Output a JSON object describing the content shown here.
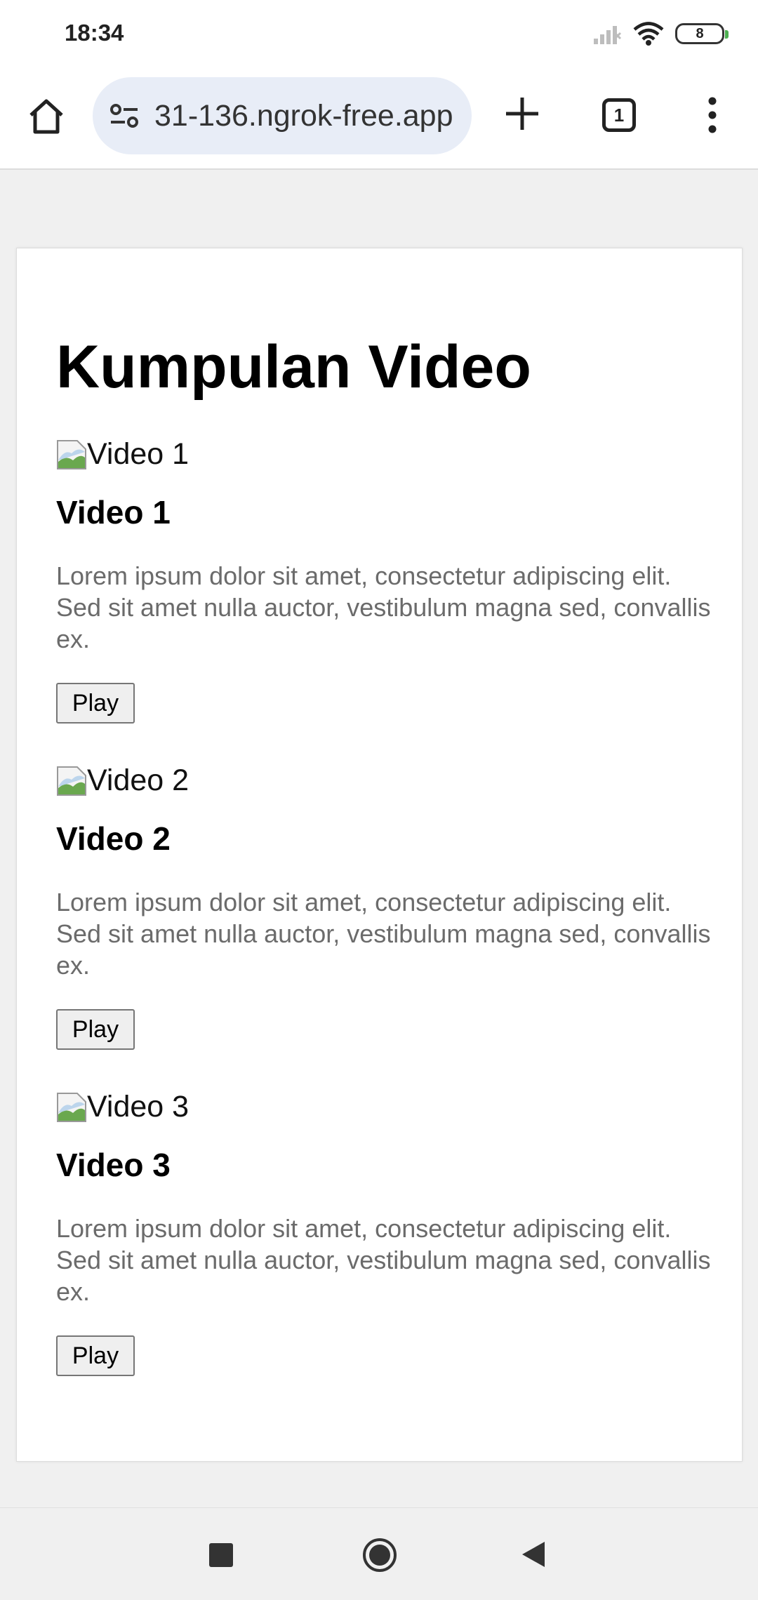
{
  "status_bar": {
    "time": "18:34",
    "battery_level": "8",
    "icons": [
      "signal-icon",
      "wifi-icon",
      "battery-icon"
    ]
  },
  "browser": {
    "url": "31-136.ngrok-free.app",
    "tab_count": "1",
    "icons": [
      "home-icon",
      "site-info-icon",
      "plus-icon",
      "tab-switcher-icon",
      "more-vert-icon"
    ]
  },
  "page": {
    "title": "Kumpulan Video",
    "videos": [
      {
        "thumb_alt": "Video 1",
        "title": "Video 1",
        "description": "Lorem ipsum dolor sit amet, consectetur adipiscing elit. Sed sit amet nulla auctor, vestibulum magna sed, convallis ex.",
        "button_label": "Play"
      },
      {
        "thumb_alt": "Video 2",
        "title": "Video 2",
        "description": "Lorem ipsum dolor sit amet, consectetur adipiscing elit. Sed sit amet nulla auctor, vestibulum magna sed, convallis ex.",
        "button_label": "Play"
      },
      {
        "thumb_alt": "Video 3",
        "title": "Video 3",
        "description": "Lorem ipsum dolor sit amet, consectetur adipiscing elit. Sed sit amet nulla auctor, vestibulum magna sed, convallis ex.",
        "button_label": "Play"
      }
    ]
  },
  "nav_bar": {
    "icons": [
      "recents-icon",
      "home-circle-icon",
      "back-icon"
    ]
  },
  "colors": {
    "page_background": "#f0f0f0",
    "url_bar_background": "#e8edf7",
    "description_text": "#6b6b6b"
  }
}
